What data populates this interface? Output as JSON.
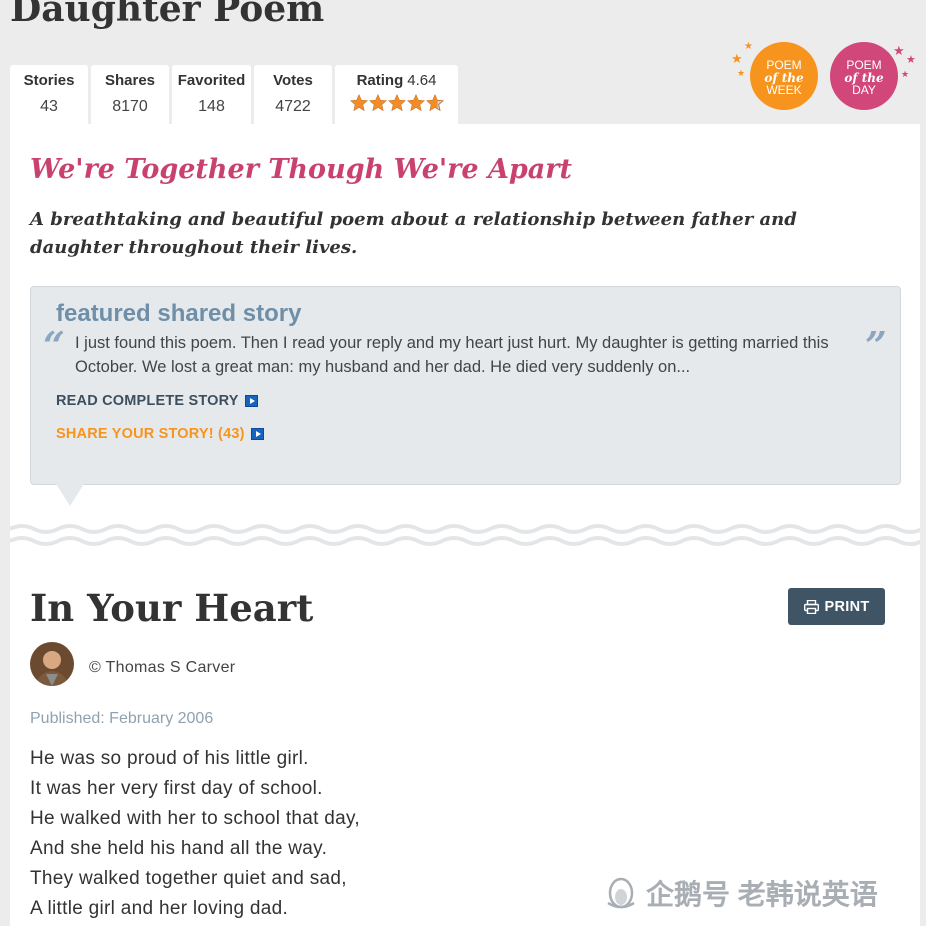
{
  "page": {
    "title": "Daughter Poem"
  },
  "stats": [
    {
      "label": "Stories",
      "value": "43"
    },
    {
      "label": "Shares",
      "value": "8170"
    },
    {
      "label": "Favorited",
      "value": "148"
    },
    {
      "label": "Votes",
      "value": "4722"
    }
  ],
  "rating": {
    "label": "Rating",
    "value": "4.64",
    "stars_out_of_5": 4.64
  },
  "badges": {
    "week": {
      "line1": "POEM",
      "line2": "of the",
      "line3": "WEEK",
      "color": "#f7941d"
    },
    "day": {
      "line1": "POEM",
      "line2": "of the",
      "line3": "DAY",
      "color": "#d1477a"
    }
  },
  "featured": {
    "title": "We're Together Though We're Apart",
    "description": "A breathtaking and beautiful poem about a relationship between father and daughter throughout their lives.",
    "story_heading": "featured shared story",
    "quote_open": "“",
    "quote_close": "”",
    "story_text": "I just found this poem. Then I read your reply and my heart just hurt. My daughter is getting married this October. We lost a great man: my husband and her dad. He died very suddenly on...",
    "read_link": "READ COMPLETE STORY",
    "share_link": "SHARE YOUR STORY! (43)"
  },
  "poem": {
    "name": "In Your Heart",
    "print_label": "PRINT",
    "author": "© Thomas S Carver",
    "published": "Published: February 2006",
    "lines": [
      "He was so proud of his little girl.",
      "It was her very first day of school.",
      "He walked with her to school that day,",
      "And she held his hand all the way.",
      "They walked together quiet and sad,",
      "A little girl and her loving dad."
    ]
  },
  "watermark": {
    "text": "企鹅号 老韩说英语"
  },
  "colors": {
    "accent_pink": "#c9426f",
    "accent_orange": "#f7941d",
    "print_button": "#3f5566",
    "story_heading": "#6f8fa8"
  }
}
